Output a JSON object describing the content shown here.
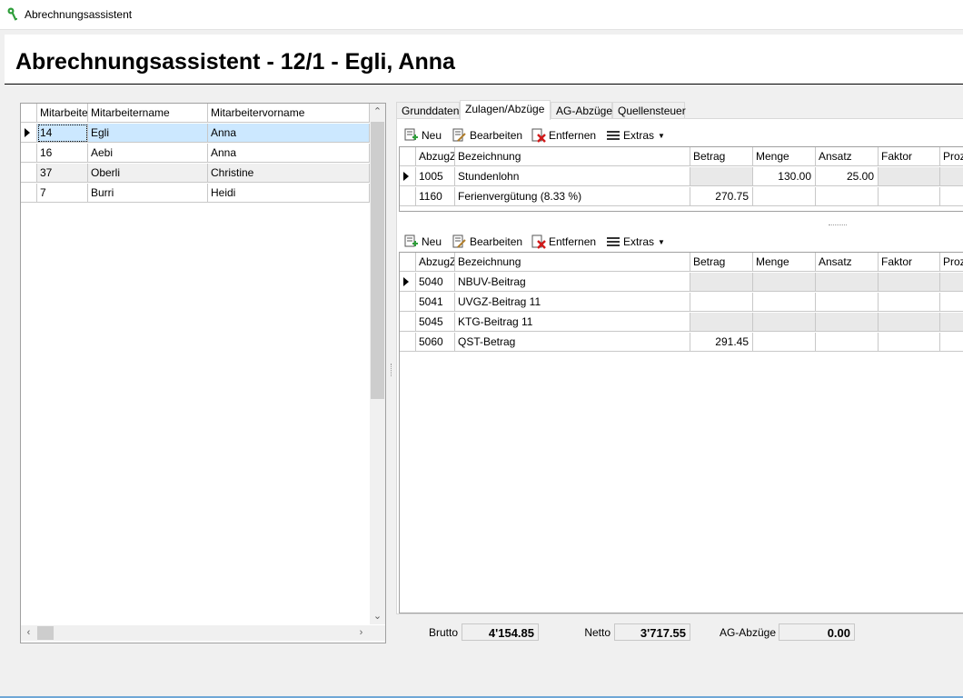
{
  "window": {
    "title": "Abrechnungsassistent",
    "icon": "green-key-icon"
  },
  "page_title": "Abrechnungsassistent - 12/1 - Egli, Anna",
  "employees": {
    "columns": [
      "Mitarbeiternummer",
      "Mitarbeitername",
      "Mitarbeitervorname"
    ],
    "columns_visible": [
      "Mitarbeiten",
      "Mitarbeitername",
      "Mitarbeitervorname"
    ],
    "rows": [
      {
        "nr": "14",
        "name": "Egli",
        "vorname": "Anna"
      },
      {
        "nr": "16",
        "name": "Aebi",
        "vorname": "Anna"
      },
      {
        "nr": "37",
        "name": "Oberli",
        "vorname": "Christine"
      },
      {
        "nr": "7",
        "name": "Burri",
        "vorname": "Heidi"
      }
    ]
  },
  "tabs": [
    {
      "label": "Grunddaten"
    },
    {
      "label": "Zulagen/Abzüge"
    },
    {
      "label": "AG-Abzüge"
    },
    {
      "label": "Quellensteuer"
    }
  ],
  "toolbar": {
    "new": "Neu",
    "edit": "Bearbeiten",
    "remove": "Entfernen",
    "extras": "Extras"
  },
  "columns": [
    "AbzugZ",
    "Bezeichnung",
    "Betrag",
    "Menge",
    "Ansatz",
    "Faktor",
    "Proze"
  ],
  "zulagen": [
    {
      "code": "1005",
      "bez": "Stundenlohn",
      "betrag": "",
      "menge": "130.00",
      "ansatz": "25.00",
      "faktor": ""
    },
    {
      "code": "1160",
      "bez": "Ferienvergütung (8.33 %)",
      "betrag": "270.75",
      "menge": "",
      "ansatz": "",
      "faktor": ""
    }
  ],
  "abzuege": [
    {
      "code": "5040",
      "bez": "NBUV-Beitrag",
      "betrag": ""
    },
    {
      "code": "5041",
      "bez": "UVGZ-Beitrag 11",
      "betrag": ""
    },
    {
      "code": "5045",
      "bez": "KTG-Beitrag 11",
      "betrag": ""
    },
    {
      "code": "5060",
      "bez": "QST-Betrag",
      "betrag": "291.45"
    }
  ],
  "totals": {
    "brutto_label": "Brutto",
    "brutto": "4'154.85",
    "netto_label": "Netto",
    "netto": "3'717.55",
    "ag_label": "AG-Abzüge",
    "ag": "0.00"
  }
}
